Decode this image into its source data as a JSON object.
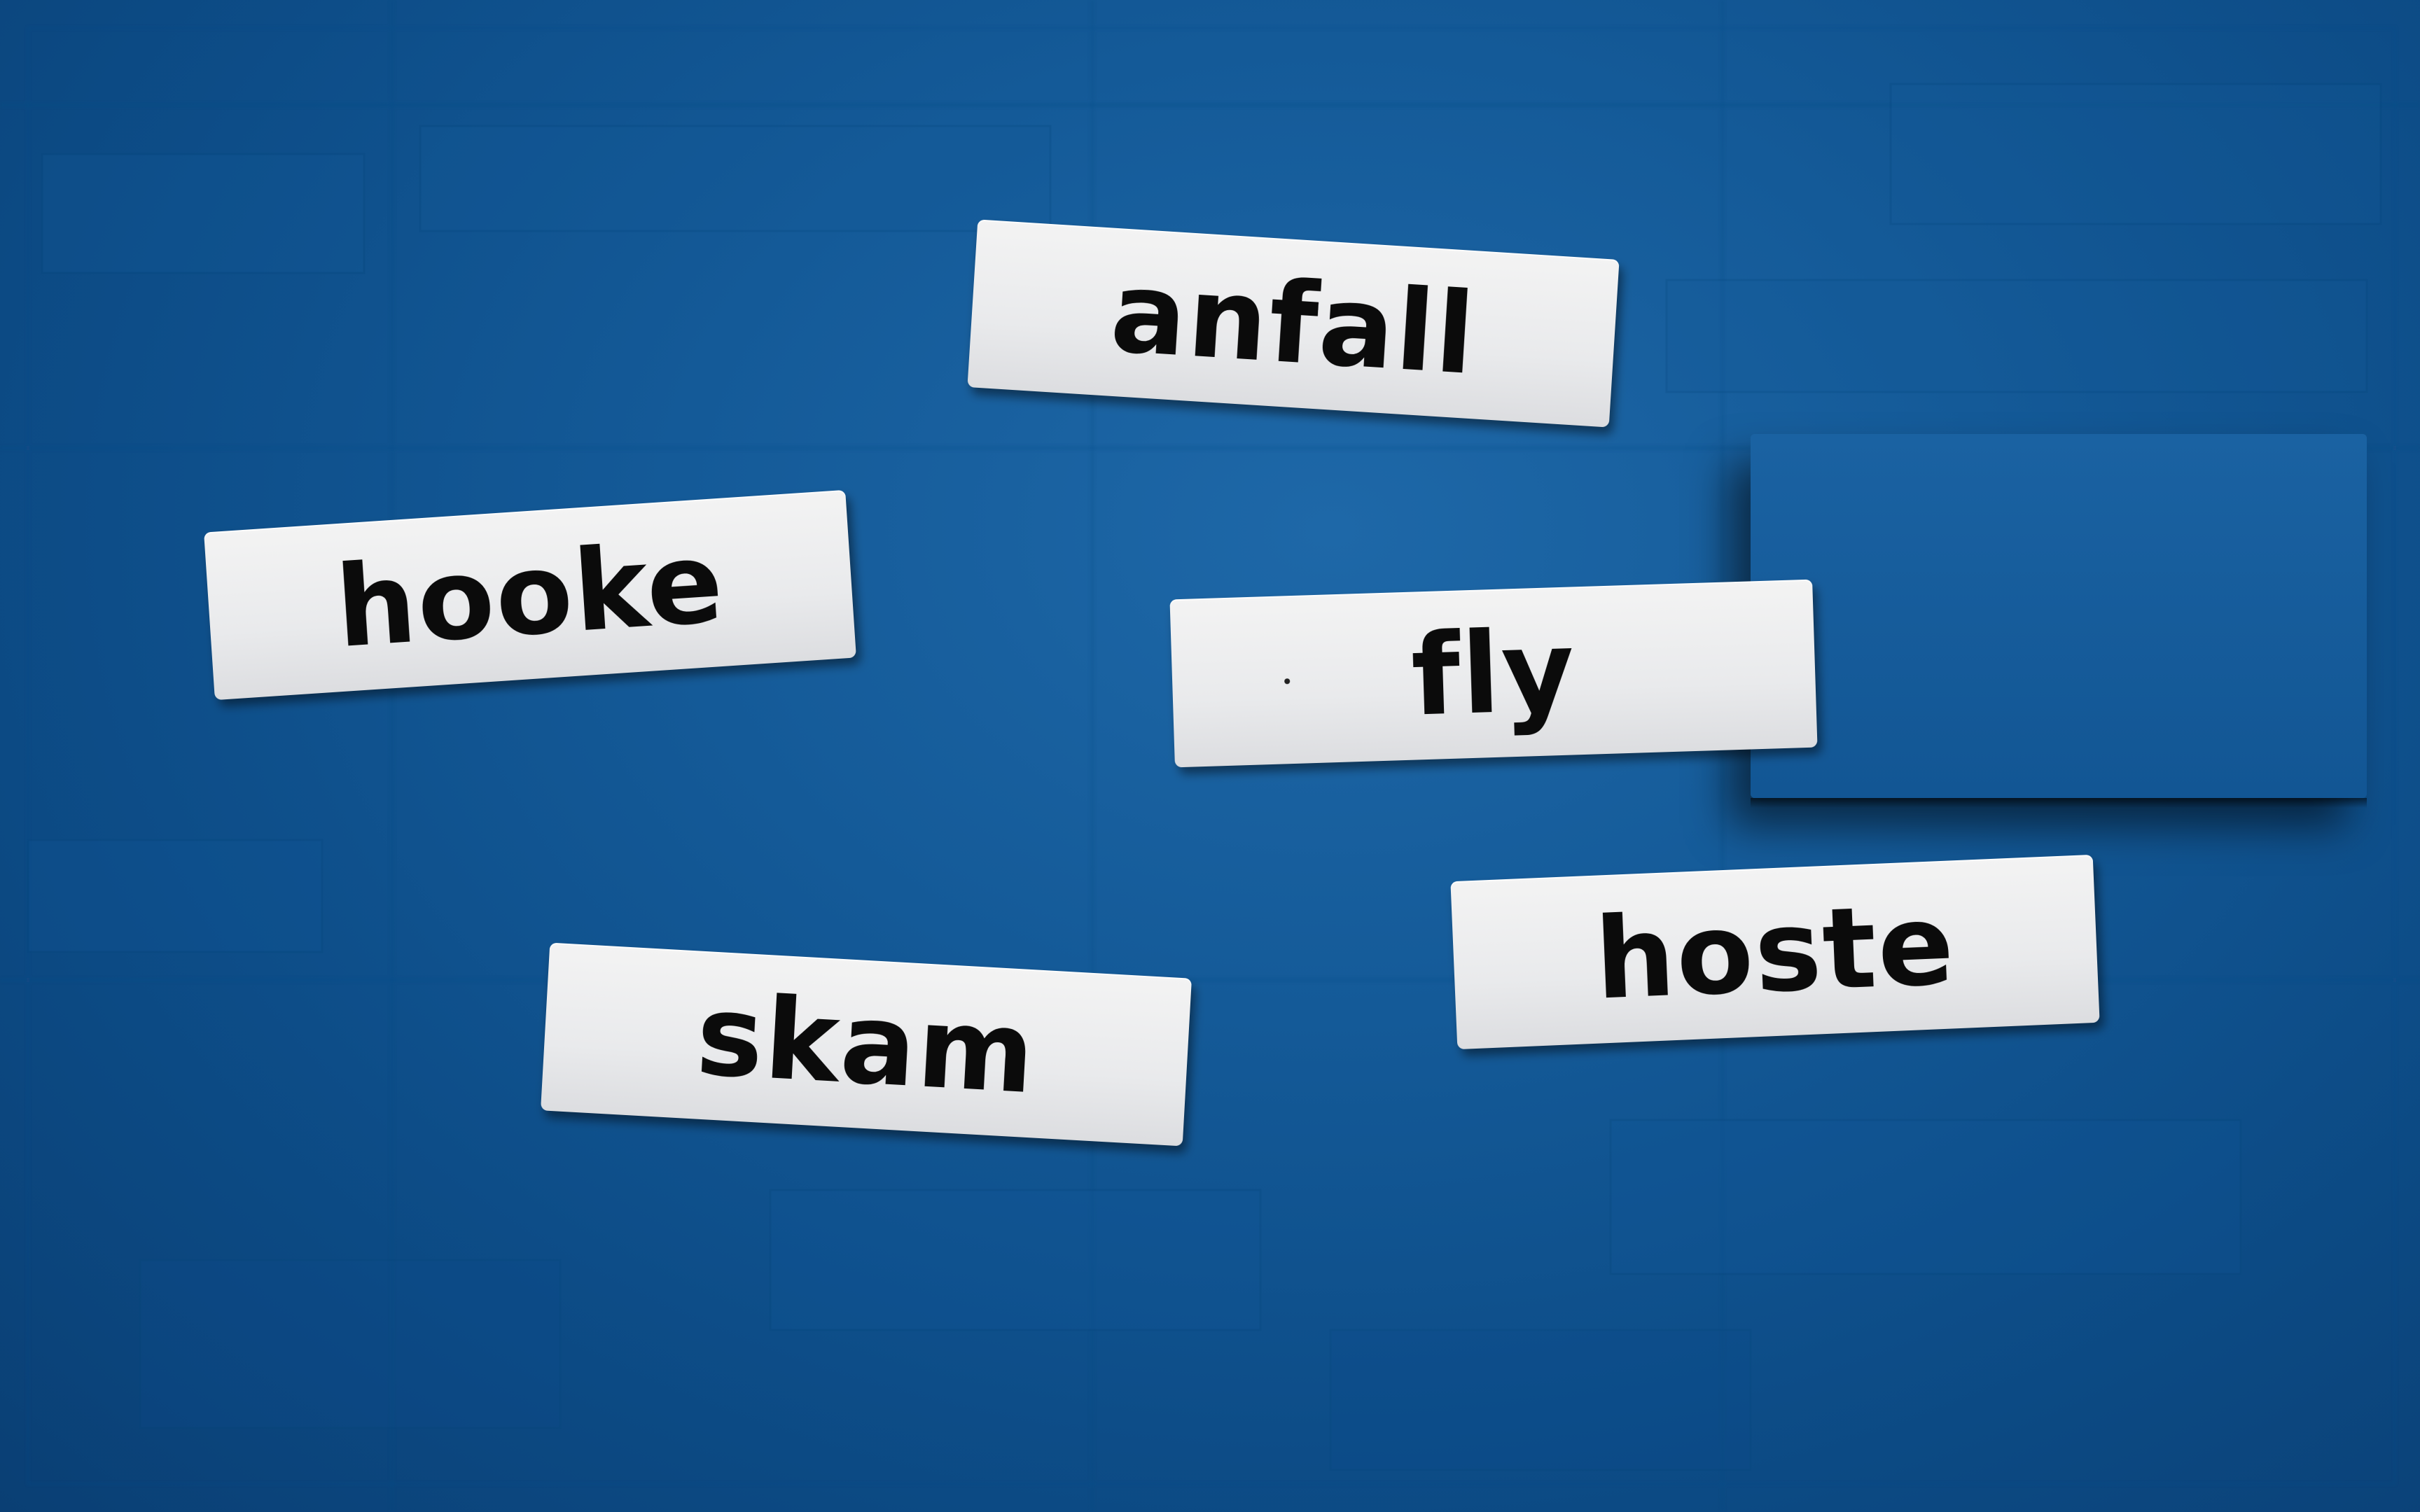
{
  "scene": {
    "background_color": "#145a98",
    "card_color": "#ececee",
    "text_color": "#0b0b0b"
  },
  "cards": [
    {
      "word": "anfall"
    },
    {
      "word": "hooke"
    },
    {
      "word": "fly"
    },
    {
      "word": "hoste"
    },
    {
      "word": "skam"
    }
  ]
}
